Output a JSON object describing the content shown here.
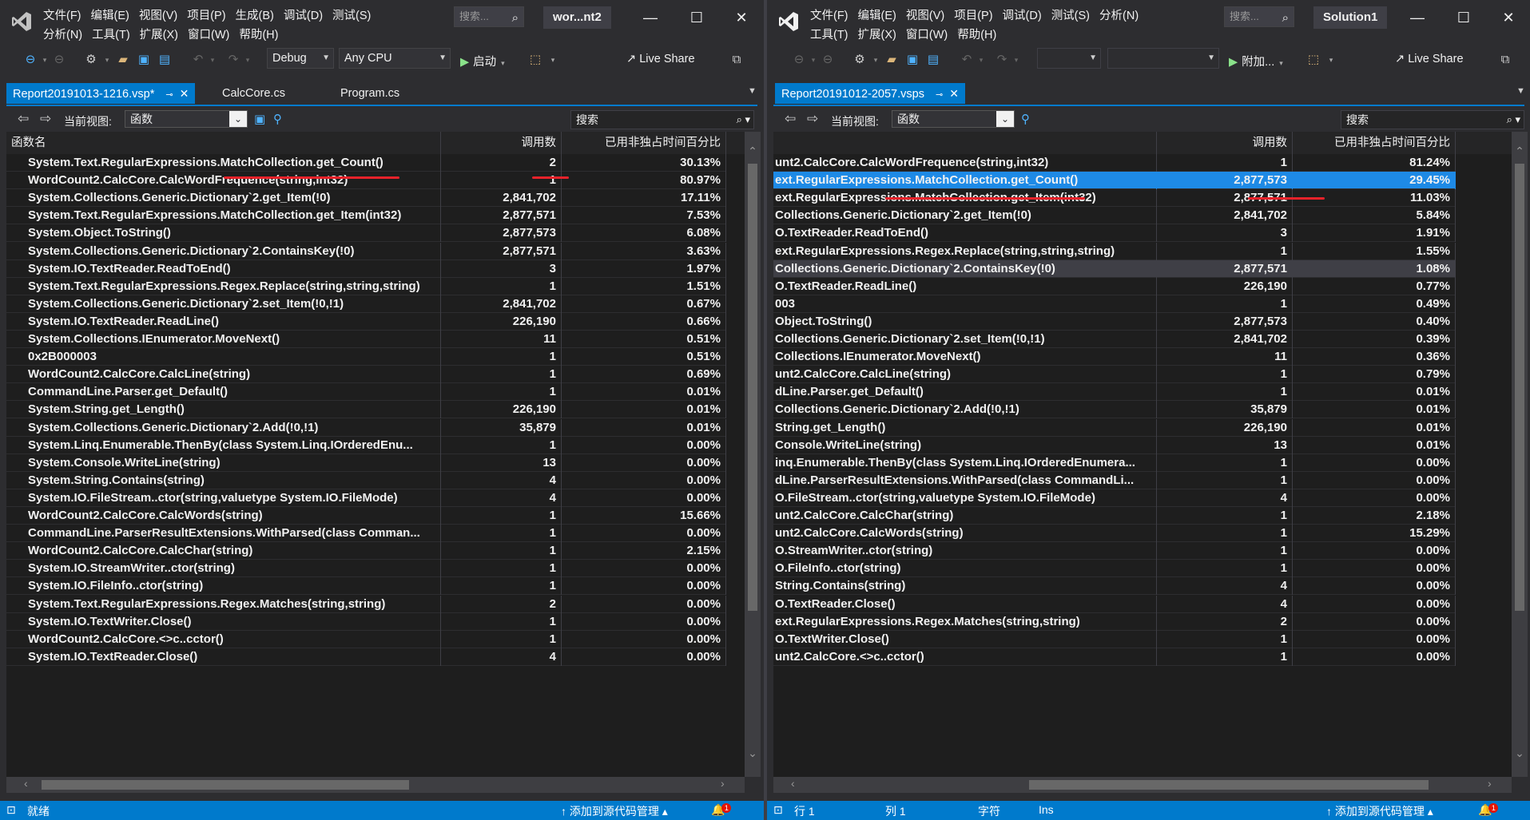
{
  "left": {
    "menu_row1": [
      "文件(F)",
      "编辑(E)",
      "视图(V)",
      "项目(P)",
      "生成(B)",
      "调试(D)",
      "测试(S)"
    ],
    "menu_row2": [
      "分析(N)",
      "工具(T)",
      "扩展(X)",
      "窗口(W)",
      "帮助(H)"
    ],
    "search_placeholder": "搜索...",
    "solution_title": "wor...nt2",
    "config": "Debug",
    "platform": "Any CPU",
    "start_label": "启动",
    "live_share": "Live Share",
    "tabs": [
      {
        "label": "Report20191013-1216.vsp*",
        "active": true
      },
      {
        "label": "CalcCore.cs",
        "active": false
      },
      {
        "label": "Program.cs",
        "active": false
      }
    ],
    "view_label": "当前视图:",
    "view_value": "函数",
    "grid_search": "搜索",
    "columns": [
      "函数名",
      "调用数",
      "已用非独占时间百分比"
    ],
    "rows": [
      [
        "System.Text.RegularExpressions.MatchCollection.get_Count()",
        "2",
        "30.13%"
      ],
      [
        "WordCount2.CalcCore.CalcWordFrequence(string,int32)",
        "1",
        "80.97%"
      ],
      [
        "System.Collections.Generic.Dictionary`2.get_Item(!0)",
        "2,841,702",
        "17.11%"
      ],
      [
        "System.Text.RegularExpressions.MatchCollection.get_Item(int32)",
        "2,877,571",
        "7.53%"
      ],
      [
        "System.Object.ToString()",
        "2,877,573",
        "6.08%"
      ],
      [
        "System.Collections.Generic.Dictionary`2.ContainsKey(!0)",
        "2,877,571",
        "3.63%"
      ],
      [
        "System.IO.TextReader.ReadToEnd()",
        "3",
        "1.97%"
      ],
      [
        "System.Text.RegularExpressions.Regex.Replace(string,string,string)",
        "1",
        "1.51%"
      ],
      [
        "System.Collections.Generic.Dictionary`2.set_Item(!0,!1)",
        "2,841,702",
        "0.67%"
      ],
      [
        "System.IO.TextReader.ReadLine()",
        "226,190",
        "0.66%"
      ],
      [
        "System.Collections.IEnumerator.MoveNext()",
        "11",
        "0.51%"
      ],
      [
        "0x2B000003",
        "1",
        "0.51%"
      ],
      [
        "WordCount2.CalcCore.CalcLine(string)",
        "1",
        "0.69%"
      ],
      [
        "CommandLine.Parser.get_Default()",
        "1",
        "0.01%"
      ],
      [
        "System.String.get_Length()",
        "226,190",
        "0.01%"
      ],
      [
        "System.Collections.Generic.Dictionary`2.Add(!0,!1)",
        "35,879",
        "0.01%"
      ],
      [
        "System.Linq.Enumerable.ThenBy(class System.Linq.IOrderedEnu...",
        "1",
        "0.00%"
      ],
      [
        "System.Console.WriteLine(string)",
        "13",
        "0.00%"
      ],
      [
        "System.String.Contains(string)",
        "4",
        "0.00%"
      ],
      [
        "System.IO.FileStream..ctor(string,valuetype System.IO.FileMode)",
        "4",
        "0.00%"
      ],
      [
        "WordCount2.CalcCore.CalcWords(string)",
        "1",
        "15.66%"
      ],
      [
        "CommandLine.ParserResultExtensions.WithParsed(class Comman...",
        "1",
        "0.00%"
      ],
      [
        "WordCount2.CalcCore.CalcChar(string)",
        "1",
        "2.15%"
      ],
      [
        "System.IO.StreamWriter..ctor(string)",
        "1",
        "0.00%"
      ],
      [
        "System.IO.FileInfo..ctor(string)",
        "1",
        "0.00%"
      ],
      [
        "System.Text.RegularExpressions.Regex.Matches(string,string)",
        "2",
        "0.00%"
      ],
      [
        "System.IO.TextWriter.Close()",
        "1",
        "0.00%"
      ],
      [
        "WordCount2.CalcCore.<>c..cctor()",
        "1",
        "0.00%"
      ],
      [
        "System.IO.TextReader.Close()",
        "4",
        "0.00%"
      ]
    ],
    "status": [
      "就绪",
      "添加到源代码管理",
      "1"
    ]
  },
  "right": {
    "menu_row1": [
      "文件(F)",
      "编辑(E)",
      "视图(V)",
      "项目(P)",
      "调试(D)",
      "测试(S)",
      "分析(N)"
    ],
    "menu_row2": [
      "工具(T)",
      "扩展(X)",
      "窗口(W)",
      "帮助(H)"
    ],
    "search_placeholder": "搜索...",
    "solution_title": "Solution1",
    "start_label": "附加...",
    "live_share": "Live Share",
    "tabs": [
      {
        "label": "Report20191012-2057.vsps",
        "active": true
      }
    ],
    "view_label": "当前视图:",
    "view_value": "函数",
    "grid_search": "搜索",
    "columns": [
      "",
      "调用数",
      "已用非独占时间百分比"
    ],
    "rows": [
      [
        "unt2.CalcCore.CalcWordFrequence(string,int32)",
        "1",
        "81.24%"
      ],
      [
        "ext.RegularExpressions.MatchCollection.get_Count()",
        "2,877,573",
        "29.45%"
      ],
      [
        "ext.RegularExpressions.MatchCollection.get_Item(int32)",
        "2,877,571",
        "11.03%"
      ],
      [
        "Collections.Generic.Dictionary`2.get_Item(!0)",
        "2,841,702",
        "5.84%"
      ],
      [
        "O.TextReader.ReadToEnd()",
        "3",
        "1.91%"
      ],
      [
        "ext.RegularExpressions.Regex.Replace(string,string,string)",
        "1",
        "1.55%"
      ],
      [
        "Collections.Generic.Dictionary`2.ContainsKey(!0)",
        "2,877,571",
        "1.08%"
      ],
      [
        "O.TextReader.ReadLine()",
        "226,190",
        "0.77%"
      ],
      [
        "003",
        "1",
        "0.49%"
      ],
      [
        "Object.ToString()",
        "2,877,573",
        "0.40%"
      ],
      [
        "Collections.Generic.Dictionary`2.set_Item(!0,!1)",
        "2,841,702",
        "0.39%"
      ],
      [
        "Collections.IEnumerator.MoveNext()",
        "11",
        "0.36%"
      ],
      [
        "unt2.CalcCore.CalcLine(string)",
        "1",
        "0.79%"
      ],
      [
        "dLine.Parser.get_Default()",
        "1",
        "0.01%"
      ],
      [
        "Collections.Generic.Dictionary`2.Add(!0,!1)",
        "35,879",
        "0.01%"
      ],
      [
        "String.get_Length()",
        "226,190",
        "0.01%"
      ],
      [
        "Console.WriteLine(string)",
        "13",
        "0.01%"
      ],
      [
        "inq.Enumerable.ThenBy(class System.Linq.IOrderedEnumera...",
        "1",
        "0.00%"
      ],
      [
        "dLine.ParserResultExtensions.WithParsed(class CommandLi...",
        "1",
        "0.00%"
      ],
      [
        "O.FileStream..ctor(string,valuetype System.IO.FileMode)",
        "4",
        "0.00%"
      ],
      [
        "unt2.CalcCore.CalcChar(string)",
        "1",
        "2.18%"
      ],
      [
        "unt2.CalcCore.CalcWords(string)",
        "1",
        "15.29%"
      ],
      [
        "O.StreamWriter..ctor(string)",
        "1",
        "0.00%"
      ],
      [
        "O.FileInfo..ctor(string)",
        "1",
        "0.00%"
      ],
      [
        "String.Contains(string)",
        "4",
        "0.00%"
      ],
      [
        "O.TextReader.Close()",
        "4",
        "0.00%"
      ],
      [
        "ext.RegularExpressions.Regex.Matches(string,string)",
        "2",
        "0.00%"
      ],
      [
        "O.TextWriter.Close()",
        "1",
        "0.00%"
      ],
      [
        "unt2.CalcCore.<>c..cctor()",
        "1",
        "0.00%"
      ]
    ],
    "selected_row": 1,
    "hover_row": 6,
    "status": [
      "行 1",
      "列 1",
      "字符",
      "Ins",
      "添加到源代码管理",
      "1"
    ]
  },
  "colors": {
    "accent": "#007acc",
    "selected_row": "#1e8ae6",
    "annotation": "#e8222a"
  }
}
